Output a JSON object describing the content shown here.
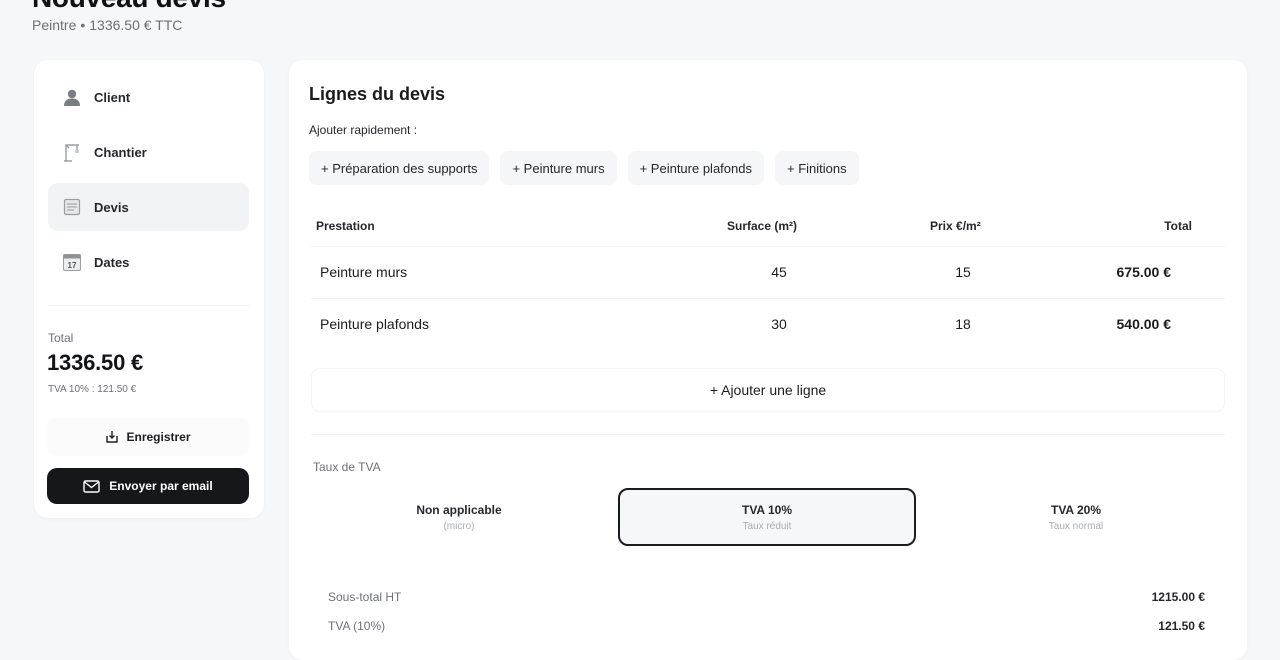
{
  "header": {
    "title": "Nouveau devis",
    "trade": "Peintre",
    "separator": "•",
    "total_ttc": "1336.50 € TTC"
  },
  "sidebar": {
    "items": [
      {
        "label": "Client",
        "icon": "user-icon"
      },
      {
        "label": "Chantier",
        "icon": "crane-icon"
      },
      {
        "label": "Devis",
        "icon": "document-icon"
      },
      {
        "label": "Dates",
        "icon": "calendar-icon"
      }
    ],
    "calendar_day": "17",
    "active": "Devis",
    "total_label": "Total",
    "total_value": "1336.50 €",
    "tva_note": "TVA 10% : 121.50 €",
    "save_label": "Enregistrer",
    "email_label": "Envoyer par email"
  },
  "main": {
    "title": "Lignes du devis",
    "quick_add_label": "Ajouter rapidement :",
    "chips": [
      "+ Préparation des supports",
      "+ Peinture murs",
      "+ Peinture plafonds",
      "+ Finitions"
    ],
    "table": {
      "headers": [
        "Prestation",
        "Surface (m²)",
        "Prix €/m²",
        "Total"
      ],
      "rows": [
        {
          "prestation": "Peinture murs",
          "surface": "45",
          "prix": "15",
          "total": "675.00 €"
        },
        {
          "prestation": "Peinture plafonds",
          "surface": "30",
          "prix": "18",
          "total": "540.00 €"
        }
      ]
    },
    "add_line_label": "+ Ajouter une ligne",
    "tva_section_label": "Taux de TVA",
    "tva_options": [
      {
        "title": "Non applicable",
        "subtitle": "(micro)"
      },
      {
        "title": "TVA 10%",
        "subtitle": "Taux réduit"
      },
      {
        "title": "TVA 20%",
        "subtitle": "Taux normal"
      }
    ],
    "tva_selected": "TVA 10%",
    "summary": [
      {
        "label": "Sous-total HT",
        "value": "1215.00 €"
      },
      {
        "label": "TVA (10%)",
        "value": "121.50 €"
      }
    ]
  },
  "colors": {
    "background": "#f6f7f8",
    "card": "#ffffff",
    "primary_button": "#16171a",
    "active_nav": "#f1f3f5",
    "muted_text": "#6d7078"
  }
}
